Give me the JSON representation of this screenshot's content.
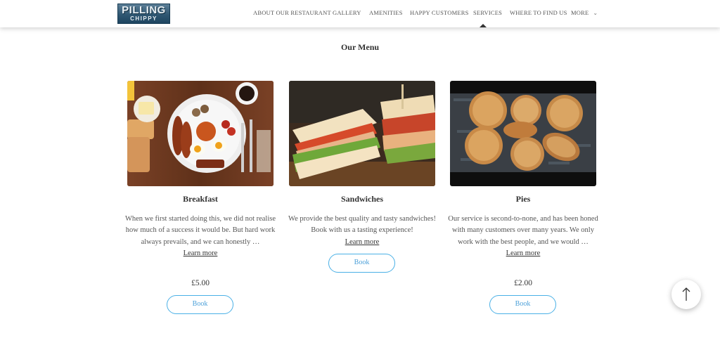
{
  "header": {
    "logo_main": "PILLING",
    "logo_sub": "CHIPPY",
    "nav": [
      {
        "label": "ABOUT OUR RESTAURANT"
      },
      {
        "label": "GALLERY"
      },
      {
        "label": "AMENITIES"
      },
      {
        "label": "HAPPY CUSTOMERS"
      },
      {
        "label": "SERVICES",
        "active": true
      },
      {
        "label": "WHERE TO FIND US"
      },
      {
        "label": "MORE"
      }
    ],
    "more_icon": "chevron-down-icon"
  },
  "section": {
    "title": "Our Menu"
  },
  "cards": [
    {
      "title": "Breakfast",
      "description": "When we first started doing this, we did not realise how much of a success it would be. But hard work always prevails, and we can honestly …",
      "learn_more": "Learn more",
      "price": "£5.00",
      "book": "Book"
    },
    {
      "title": "Sandwiches",
      "description": "We provide the best quality and tasty sandwiches! Book with us a tasting experience!",
      "learn_more": "Learn more",
      "price": "",
      "book": "Book"
    },
    {
      "title": "Pies",
      "description": "Our service is second-to-none, and has been honed with many customers over many years. We only work with the best people, and we would …",
      "learn_more": "Learn more",
      "price": "£2.00",
      "book": "Book"
    }
  ],
  "scroll_top_icon": "arrow-up-icon",
  "colors": {
    "accent": "#4ab0e6",
    "text": "#333333",
    "logo": "#2f5772"
  }
}
